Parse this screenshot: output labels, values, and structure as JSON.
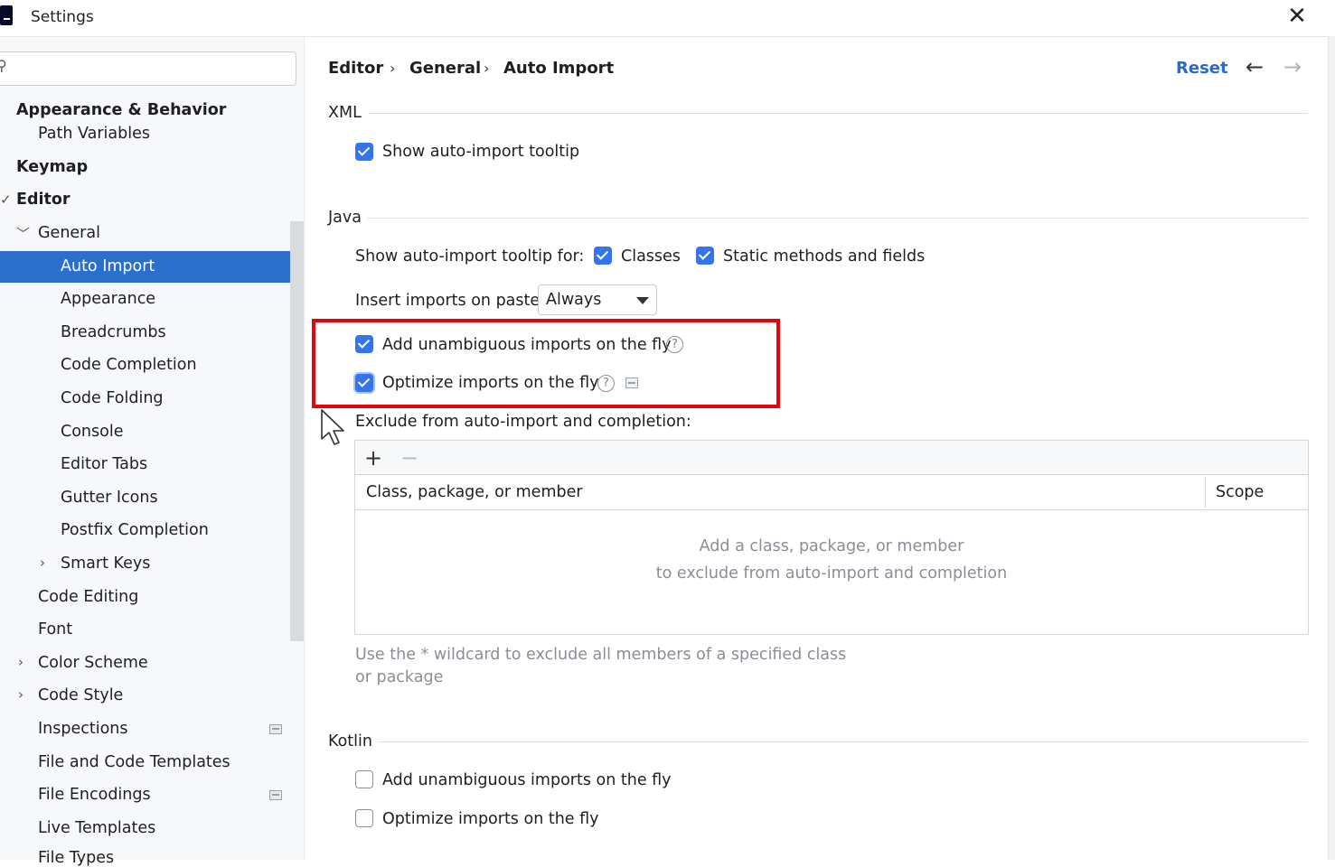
{
  "window": {
    "title": "Settings",
    "close_icon": "close-icon"
  },
  "sidebar": {
    "search_placeholder": "",
    "items": [
      {
        "label": "Appearance & Behavior"
      },
      {
        "label": "Path Variables"
      },
      {
        "label": "Keymap"
      },
      {
        "label": "Editor"
      },
      {
        "label": "General"
      },
      {
        "label": "Auto Import"
      },
      {
        "label": "Appearance"
      },
      {
        "label": "Breadcrumbs"
      },
      {
        "label": "Code Completion"
      },
      {
        "label": "Code Folding"
      },
      {
        "label": "Console"
      },
      {
        "label": "Editor Tabs"
      },
      {
        "label": "Gutter Icons"
      },
      {
        "label": "Postfix Completion"
      },
      {
        "label": "Smart Keys"
      },
      {
        "label": "Code Editing"
      },
      {
        "label": "Font"
      },
      {
        "label": "Color Scheme"
      },
      {
        "label": "Code Style"
      },
      {
        "label": "Inspections"
      },
      {
        "label": "File and Code Templates"
      },
      {
        "label": "File Encodings"
      },
      {
        "label": "Live Templates"
      },
      {
        "label": "File Types"
      }
    ],
    "selected": "Auto Import"
  },
  "breadcrumb": [
    "Editor",
    "General",
    "Auto Import"
  ],
  "header": {
    "reset_label": "Reset"
  },
  "xml": {
    "section": "XML",
    "show_tooltip": {
      "label": "Show auto-import tooltip",
      "checked": true
    }
  },
  "java": {
    "section": "Java",
    "tooltip_for_label": "Show auto-import tooltip for:",
    "classes": {
      "label": "Classes",
      "checked": true
    },
    "static_methods": {
      "label": "Static methods and fields",
      "checked": true
    },
    "insert_on_paste_label": "Insert imports on paste:",
    "insert_on_paste_value": "Always",
    "add_unambiguous": {
      "label": "Add unambiguous imports on the fly",
      "checked": true
    },
    "optimize": {
      "label": "Optimize imports on the fly",
      "checked": true
    },
    "exclude_label": "Exclude from auto-import and completion:",
    "table": {
      "columns": [
        "Class, package, or member",
        "Scope"
      ],
      "empty_line1": "Add a class, package, or member",
      "empty_line2": "to exclude from auto-import and completion"
    },
    "hint": "Use the * wildcard to exclude all members of a specified class or package"
  },
  "kotlin": {
    "section": "Kotlin",
    "add_unambiguous": {
      "label": "Add unambiguous imports on the fly",
      "checked": false
    },
    "optimize": {
      "label": "Optimize imports on the fly",
      "checked": false
    }
  },
  "colors": {
    "accent": "#3574f0",
    "selection": "#2b6fcc",
    "highlight_box": "#e8000b",
    "link": "#2a6ac8"
  }
}
